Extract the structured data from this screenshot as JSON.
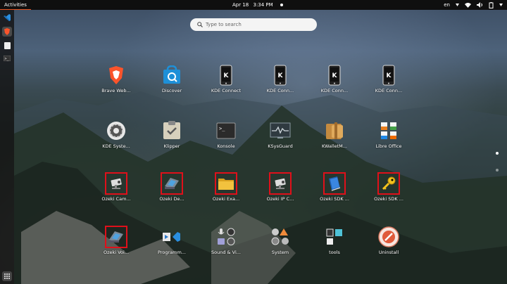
{
  "topbar": {
    "activities": "Activities",
    "date": "Apr 18",
    "time": "3:34 PM",
    "lang": "en"
  },
  "search": {
    "placeholder": "Type to search"
  },
  "apps": [
    {
      "label": "Brave Web...",
      "icon": "brave-icon"
    },
    {
      "label": "Discover",
      "icon": "discover-icon"
    },
    {
      "label": "KDE Connect",
      "icon": "kde-connect-icon"
    },
    {
      "label": "KDE Conn...",
      "icon": "kde-connect-icon"
    },
    {
      "label": "KDE Conn...",
      "icon": "kde-connect-icon"
    },
    {
      "label": "KDE Conn...",
      "icon": "kde-connect-icon"
    },
    {
      "label": "KDE Syste...",
      "icon": "gear-icon"
    },
    {
      "label": "Klipper",
      "icon": "klipper-icon"
    },
    {
      "label": "Konsole",
      "icon": "terminal-icon"
    },
    {
      "label": "KSysGuard",
      "icon": "monitor-graph-icon"
    },
    {
      "label": "KWalletM...",
      "icon": "wallet-icon"
    },
    {
      "label": "Libre Office",
      "icon": "libreoffice-folder-icon"
    },
    {
      "label": "Ozeki Cam...",
      "icon": "camera-icon"
    },
    {
      "label": "Ozeki De...",
      "icon": "phone-icon"
    },
    {
      "label": "Ozeki Exa...",
      "icon": "folder-icon"
    },
    {
      "label": "Ozeki IP C...",
      "icon": "camera-icon"
    },
    {
      "label": "Ozeki SDK ...",
      "icon": "book-icon"
    },
    {
      "label": "Ozeki SDK ...",
      "icon": "key-icon"
    },
    {
      "label": "Ozeki Voi...",
      "icon": "phone-icon"
    },
    {
      "label": "Programm...",
      "icon": "programming-folder-icon"
    },
    {
      "label": "Sound & Vi...",
      "icon": "sound-video-folder-icon"
    },
    {
      "label": "System",
      "icon": "system-folder-icon"
    },
    {
      "label": "tools",
      "icon": "tools-folder-icon"
    },
    {
      "label": "Uninstall",
      "icon": "uninstall-icon"
    }
  ],
  "colors": {
    "highlight": "#e0101a",
    "accent": "#e95420"
  }
}
